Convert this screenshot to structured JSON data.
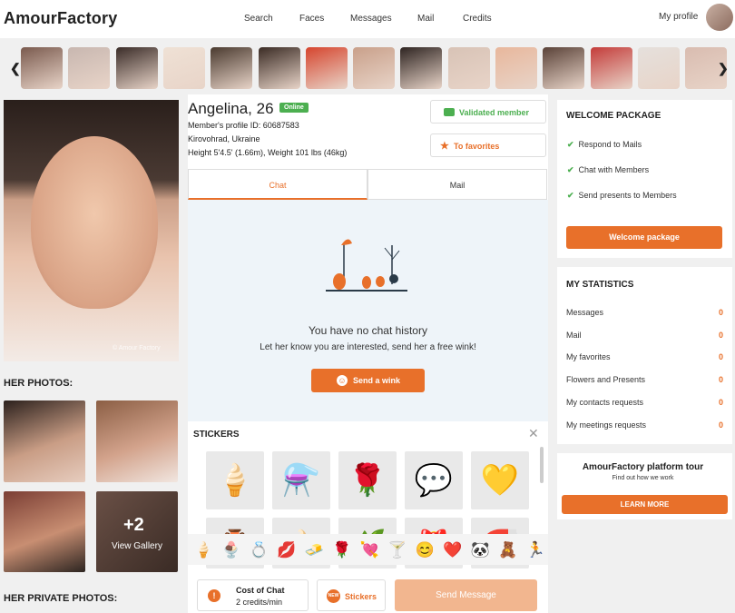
{
  "header": {
    "logo": "AmourFactory",
    "nav": [
      "Search",
      "Faces",
      "Messages",
      "Mail",
      "Credits"
    ],
    "my_profile": "My profile"
  },
  "carousel": {
    "prev_icon": "chevron-left-icon",
    "next_icon": "chevron-right-icon",
    "thumb_colors": [
      "#7a5a4e",
      "#c8b7b0",
      "#3a2c28",
      "#efe1d5",
      "#4a3a2f",
      "#3a2b24",
      "#d6452e",
      "#c9a08a",
      "#2e2421",
      "#d8c3b6",
      "#e8b79c",
      "#5a4238",
      "#c43c3a",
      "#e5e0dc",
      "#d9bcb0"
    ]
  },
  "profile": {
    "name": "Angelina, 26",
    "online_badge": "Online",
    "profile_id": "Member's profile ID: 60687583",
    "location": "Kirovohrad, Ukraine",
    "height_weight": "Height 5'4.5' (1.66m), Weight 101 lbs (46kg)",
    "photo_caption": "© Amour Factory",
    "validated_label": "Validated member",
    "favorites_label": "To favorites"
  },
  "left": {
    "her_photos_title": "HER PHOTOS:",
    "gallery_count": "+2",
    "view_gallery": "View Gallery",
    "private_photos_title": "HER PRIVATE PHOTOS:"
  },
  "tabs": {
    "chat": "Chat",
    "mail": "Mail"
  },
  "chat": {
    "empty_title": "You have no chat history",
    "empty_sub": "Let her know you are interested, send her a free wink!",
    "wink_label": "Send a wink"
  },
  "stickers": {
    "title": "STICKERS",
    "grid": [
      "🍦",
      "⚗️",
      "🌹",
      "💬",
      "💛",
      "🏺",
      "🍦",
      "🌿",
      "🎁",
      "🧲"
    ],
    "bar": [
      "🍦",
      "🍨",
      "💍",
      "💋",
      "🧈",
      "🌹",
      "💘",
      "🍸",
      "😊",
      "❤️",
      "🐼",
      "🧸",
      "🏃"
    ]
  },
  "composer": {
    "cost_title": "Cost of Chat",
    "cost_value": "2 credits/min",
    "stickers_label": "Stickers",
    "stickers_badge": "NEW",
    "send_label": "Send Message"
  },
  "welcome": {
    "title": "WELCOME PACKAGE",
    "items": [
      "Respond to Mails",
      "Chat with Members",
      "Send presents to Members"
    ],
    "button": "Welcome package"
  },
  "stats": {
    "title": "MY STATISTICS",
    "rows": [
      {
        "label": "Messages",
        "value": "0"
      },
      {
        "label": "Mail",
        "value": "0"
      },
      {
        "label": "My favorites",
        "value": "0"
      },
      {
        "label": "Flowers and Presents",
        "value": "0"
      },
      {
        "label": "My contacts requests",
        "value": "0"
      },
      {
        "label": "My meetings requests",
        "value": "0"
      }
    ]
  },
  "tour": {
    "title": "AmourFactory platform tour",
    "subtitle": "Find out how we work",
    "button": "LEARN MORE"
  },
  "colors": {
    "accent": "#e8702a",
    "online": "#4caf50"
  }
}
